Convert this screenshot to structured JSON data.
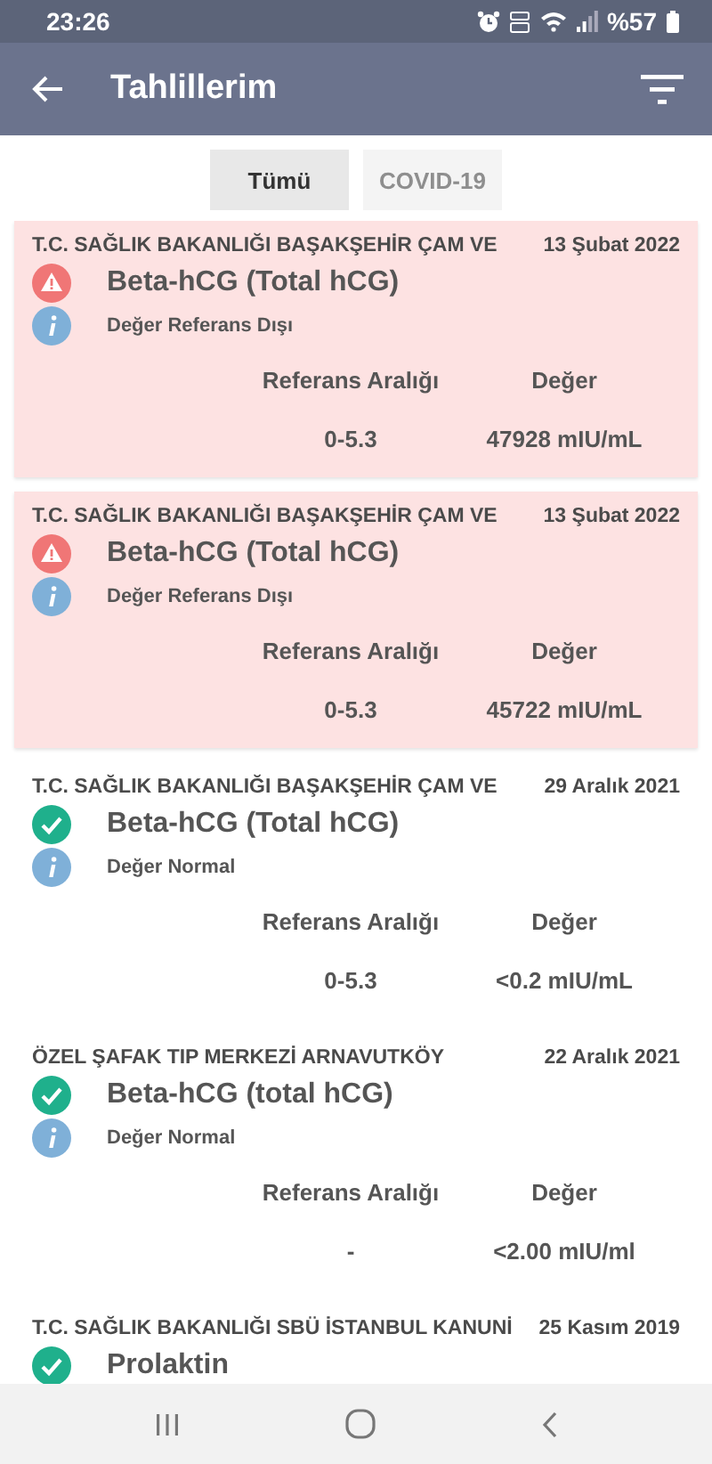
{
  "status_bar": {
    "time": "23:26",
    "battery": "%57"
  },
  "app_bar": {
    "title": "Tahlillerim"
  },
  "tabs": [
    {
      "label": "Tümü",
      "selected": true
    },
    {
      "label": "COVID-19",
      "selected": false
    }
  ],
  "results": [
    {
      "hospital": "T.C. SAĞLIK BAKANLIĞI BAŞAKŞEHİR ÇAM VE",
      "date": "13 Şubat 2022",
      "test": "Beta-hCG (Total hCG)",
      "kind": "alert",
      "status": "Değer Referans Dışı",
      "ref_label": "Referans Aralığı",
      "value_label": "Değer",
      "ref": "0-5.3",
      "value": "47928 mIU/mL"
    },
    {
      "hospital": "T.C. SAĞLIK BAKANLIĞI BAŞAKŞEHİR ÇAM VE",
      "date": "13 Şubat 2022",
      "test": "Beta-hCG (Total hCG)",
      "kind": "alert",
      "status": "Değer Referans Dışı",
      "ref_label": "Referans Aralığı",
      "value_label": "Değer",
      "ref": "0-5.3",
      "value": "45722 mIU/mL"
    },
    {
      "hospital": "T.C. SAĞLIK BAKANLIĞI BAŞAKŞEHİR ÇAM VE",
      "date": "29 Aralık 2021",
      "test": "Beta-hCG (Total hCG)",
      "kind": "normal",
      "status": "Değer Normal",
      "ref_label": "Referans Aralığı",
      "value_label": "Değer",
      "ref": "0-5.3",
      "value": "<0.2 mIU/mL"
    },
    {
      "hospital": "ÖZEL ŞAFAK TIP MERKEZİ ARNAVUTKÖY",
      "date": "22 Aralık 2021",
      "test": "Beta-hCG (total hCG)",
      "kind": "normal",
      "status": "Değer Normal",
      "ref_label": "Referans Aralığı",
      "value_label": "Değer",
      "ref": "-",
      "value": "<2.00 mIU/ml"
    },
    {
      "hospital": "T.C. SAĞLIK BAKANLIĞI SBÜ İSTANBUL KANUNİ",
      "date": "25 Kasım 2019",
      "test": "Prolaktin",
      "kind": "normal"
    }
  ]
}
